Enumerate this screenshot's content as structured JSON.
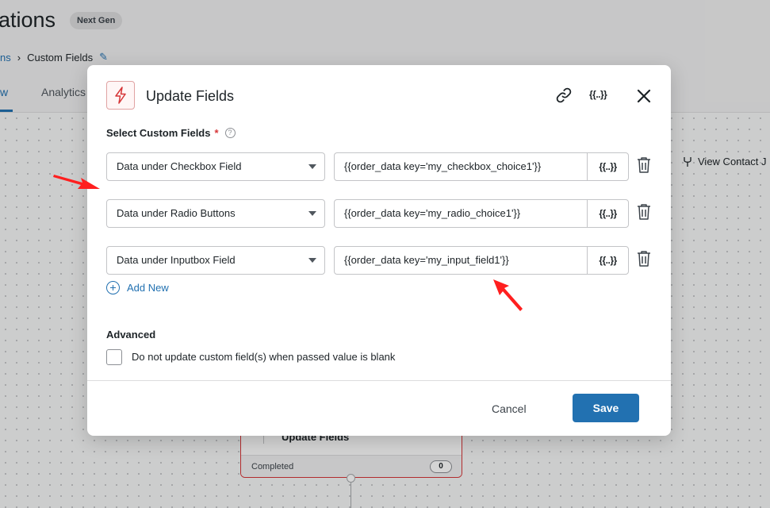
{
  "background": {
    "page_title": "ations",
    "badge": "Next Gen",
    "breadcrumb": {
      "parent": "ns",
      "current": "Custom Fields"
    },
    "tabs": {
      "active": "w",
      "analytics": "Analytics"
    },
    "view_contact": "View Contact J",
    "node": {
      "title": "Update Fields",
      "status": "Completed",
      "count": "0"
    }
  },
  "modal": {
    "title": "Update Fields",
    "merge_tag_label": "{{..}}",
    "section_label": "Select Custom Fields",
    "required_mark": "*",
    "help_icon": "?",
    "rows": [
      {
        "field": "Data under Checkbox Field",
        "value": "{{order_data key='my_checkbox_choice1'}}",
        "merge": "{{..}}"
      },
      {
        "field": "Data under Radio Buttons",
        "value": "{{order_data key='my_radio_choice1'}}",
        "merge": "{{..}}"
      },
      {
        "field": "Data under Inputbox Field",
        "value": "{{order_data key='my_input_field1'}}",
        "merge": "{{..}}"
      }
    ],
    "add_new": "Add New",
    "advanced_label": "Advanced",
    "checkbox_label": "Do not update custom field(s) when passed value is blank",
    "checkbox_checked": false,
    "cancel": "Cancel",
    "save": "Save"
  },
  "colors": {
    "accent": "#2271b1",
    "danger": "#d63638",
    "annotation_arrow": "#ff1f1f"
  },
  "icons": [
    "lightning-icon",
    "link-icon",
    "close-icon",
    "trash-icon",
    "add-circle-icon",
    "help-icon"
  ]
}
